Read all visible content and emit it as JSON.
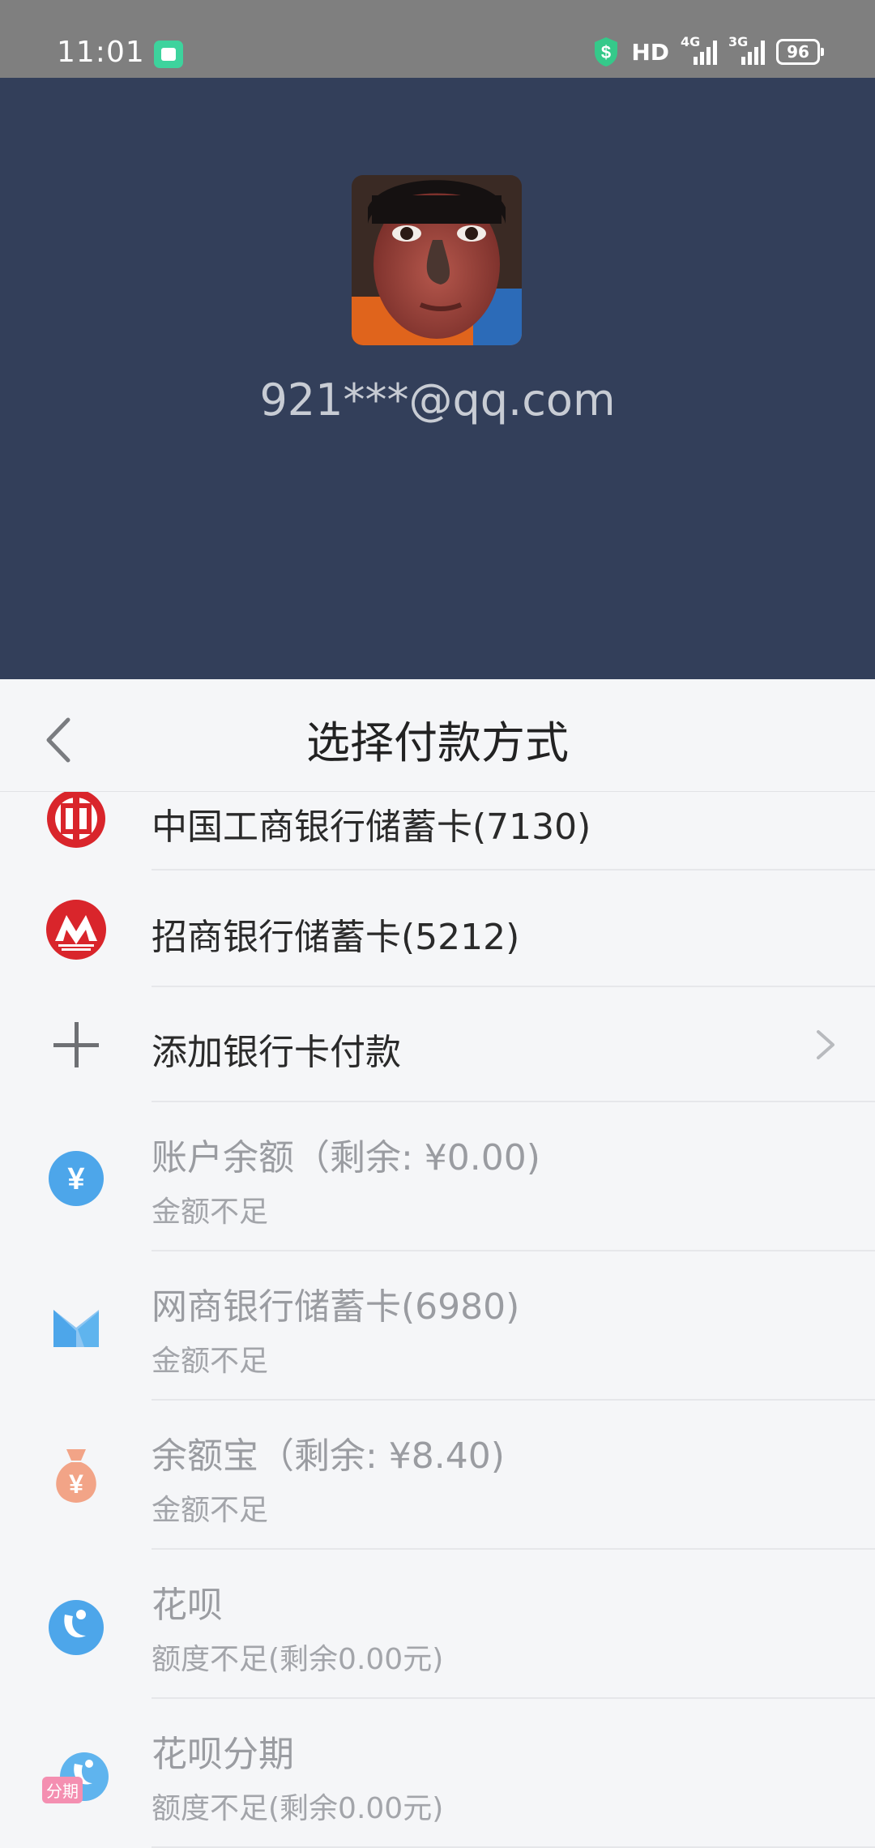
{
  "status_bar": {
    "time": "11:01",
    "hd": "HD",
    "net1": "4G",
    "net2": "3G",
    "battery": "96"
  },
  "header": {
    "account": "921***@qq.com"
  },
  "sheet": {
    "title": "选择付款方式",
    "methods": [
      {
        "label": "中国工商银行储蓄卡(7130)",
        "icon": "icbc-logo-icon"
      },
      {
        "label": "招商银行储蓄卡(5212)",
        "icon": "cmb-logo-icon"
      },
      {
        "label": "添加银行卡付款",
        "icon": "plus-icon"
      },
      {
        "label": "账户余额（剩余: ¥0.00)",
        "sub": "金额不足",
        "icon": "yuan-balance-icon"
      },
      {
        "label": "网商银行储蓄卡(6980)",
        "sub": "金额不足",
        "icon": "mybank-logo-icon"
      },
      {
        "label": "余额宝（剩余: ¥8.40)",
        "sub": "金额不足",
        "icon": "money-bag-icon"
      },
      {
        "label": "花呗",
        "sub": "额度不足(剩余0.00元)",
        "icon": "huabei-icon"
      },
      {
        "label": "花呗分期",
        "sub": "额度不足(剩余0.00元)",
        "icon": "huabei-installment-icon",
        "badge": "分期"
      }
    ]
  },
  "colors": {
    "header_bg": "#333f5a",
    "status_bg": "#7f7f7f",
    "icbc_red": "#d9252b",
    "blue_icon": "#4da6ea",
    "peach_icon": "#f2a487"
  }
}
